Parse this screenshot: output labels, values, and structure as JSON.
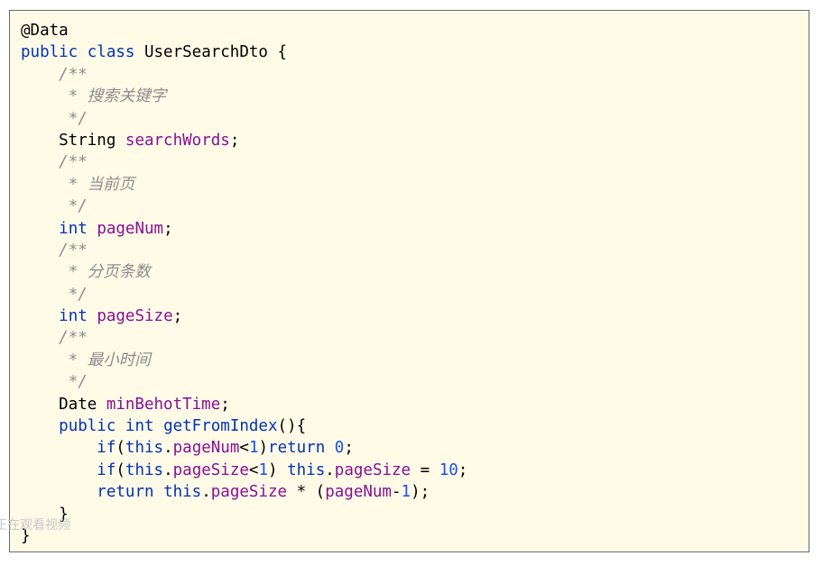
{
  "code": {
    "lines": [
      [
        {
          "t": "@Data",
          "c": "plain"
        }
      ],
      [
        {
          "t": "public class",
          "c": "kw"
        },
        {
          "t": " UserSearchDto {",
          "c": "plain"
        }
      ],
      [
        {
          "t": "    ",
          "c": "plain"
        },
        {
          "t": "/**",
          "c": "comment"
        }
      ],
      [
        {
          "t": "     ",
          "c": "plain"
        },
        {
          "t": "* 搜索关键字",
          "c": "comment"
        }
      ],
      [
        {
          "t": "     ",
          "c": "plain"
        },
        {
          "t": "*/",
          "c": "comment"
        }
      ],
      [
        {
          "t": "    String ",
          "c": "plain"
        },
        {
          "t": "searchWords",
          "c": "field"
        },
        {
          "t": ";",
          "c": "plain"
        }
      ],
      [
        {
          "t": "    ",
          "c": "plain"
        },
        {
          "t": "/**",
          "c": "comment"
        }
      ],
      [
        {
          "t": "     ",
          "c": "plain"
        },
        {
          "t": "* 当前页",
          "c": "comment"
        }
      ],
      [
        {
          "t": "     ",
          "c": "plain"
        },
        {
          "t": "*/",
          "c": "comment"
        }
      ],
      [
        {
          "t": "    ",
          "c": "plain"
        },
        {
          "t": "int",
          "c": "kw"
        },
        {
          "t": " ",
          "c": "plain"
        },
        {
          "t": "pageNum",
          "c": "field"
        },
        {
          "t": ";",
          "c": "plain"
        }
      ],
      [
        {
          "t": "    ",
          "c": "plain"
        },
        {
          "t": "/**",
          "c": "comment"
        }
      ],
      [
        {
          "t": "     ",
          "c": "plain"
        },
        {
          "t": "* 分页条数",
          "c": "comment"
        }
      ],
      [
        {
          "t": "     ",
          "c": "plain"
        },
        {
          "t": "*/",
          "c": "comment"
        }
      ],
      [
        {
          "t": "    ",
          "c": "plain"
        },
        {
          "t": "int",
          "c": "kw"
        },
        {
          "t": " ",
          "c": "plain"
        },
        {
          "t": "pageSize",
          "c": "field"
        },
        {
          "t": ";",
          "c": "plain"
        }
      ],
      [
        {
          "t": "    ",
          "c": "plain"
        },
        {
          "t": "/**",
          "c": "comment"
        }
      ],
      [
        {
          "t": "     ",
          "c": "plain"
        },
        {
          "t": "* 最小时间",
          "c": "comment"
        }
      ],
      [
        {
          "t": "     ",
          "c": "plain"
        },
        {
          "t": "*/",
          "c": "comment"
        }
      ],
      [
        {
          "t": "    Date ",
          "c": "plain"
        },
        {
          "t": "minBehotTime",
          "c": "field"
        },
        {
          "t": ";",
          "c": "plain"
        }
      ],
      [
        {
          "t": "    ",
          "c": "plain"
        },
        {
          "t": "public int",
          "c": "kw"
        },
        {
          "t": " ",
          "c": "plain"
        },
        {
          "t": "getFromIndex",
          "c": "kw"
        },
        {
          "t": "(){",
          "c": "plain"
        }
      ],
      [
        {
          "t": "        ",
          "c": "plain"
        },
        {
          "t": "if",
          "c": "kw"
        },
        {
          "t": "(",
          "c": "plain"
        },
        {
          "t": "this",
          "c": "kw"
        },
        {
          "t": ".",
          "c": "plain"
        },
        {
          "t": "pageNum",
          "c": "field"
        },
        {
          "t": "<",
          "c": "plain"
        },
        {
          "t": "1",
          "c": "num"
        },
        {
          "t": ")",
          "c": "plain"
        },
        {
          "t": "return",
          "c": "kw"
        },
        {
          "t": " ",
          "c": "plain"
        },
        {
          "t": "0",
          "c": "num"
        },
        {
          "t": ";",
          "c": "plain"
        }
      ],
      [
        {
          "t": "        ",
          "c": "plain"
        },
        {
          "t": "if",
          "c": "kw"
        },
        {
          "t": "(",
          "c": "plain"
        },
        {
          "t": "this",
          "c": "kw"
        },
        {
          "t": ".",
          "c": "plain"
        },
        {
          "t": "pageSize",
          "c": "field"
        },
        {
          "t": "<",
          "c": "plain"
        },
        {
          "t": "1",
          "c": "num"
        },
        {
          "t": ") ",
          "c": "plain"
        },
        {
          "t": "this",
          "c": "kw"
        },
        {
          "t": ".",
          "c": "plain"
        },
        {
          "t": "pageSize",
          "c": "field"
        },
        {
          "t": " = ",
          "c": "plain"
        },
        {
          "t": "10",
          "c": "num"
        },
        {
          "t": ";",
          "c": "plain"
        }
      ],
      [
        {
          "t": "        ",
          "c": "plain"
        },
        {
          "t": "return",
          "c": "kw"
        },
        {
          "t": " ",
          "c": "plain"
        },
        {
          "t": "this",
          "c": "kw"
        },
        {
          "t": ".",
          "c": "plain"
        },
        {
          "t": "pageSize",
          "c": "field"
        },
        {
          "t": " * (",
          "c": "plain"
        },
        {
          "t": "pageNum",
          "c": "field"
        },
        {
          "t": "-",
          "c": "plain"
        },
        {
          "t": "1",
          "c": "num"
        },
        {
          "t": ");",
          "c": "plain"
        }
      ],
      [
        {
          "t": "    }",
          "c": "plain"
        }
      ],
      [
        {
          "t": "}",
          "c": "plain"
        }
      ]
    ]
  },
  "watermark": {
    "text": "正在观看视频"
  },
  "colors": {
    "background": "#fffbe7",
    "keyword": "#0033b3",
    "field": "#871094",
    "number": "#1750eb",
    "comment": "#8c8c8c"
  }
}
